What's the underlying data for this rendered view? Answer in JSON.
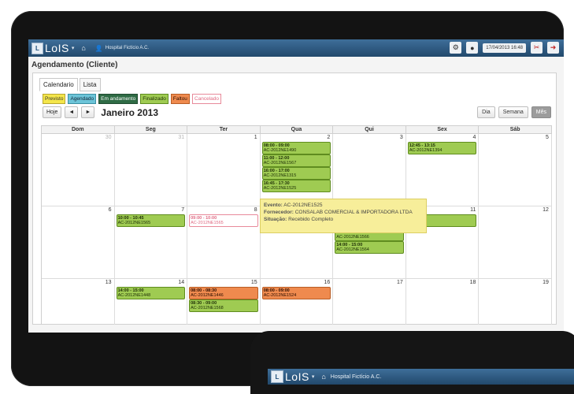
{
  "topbar": {
    "app_name": "LoIS",
    "caret": "▾",
    "home_icon": "⌂",
    "user_icon": "👤",
    "user_name": "Hospital Fictício A.C.",
    "datetime": "17/04/2013 16:48"
  },
  "page_title": "Agendamento (Cliente)",
  "tabs": [
    {
      "label": "Calendario"
    },
    {
      "label": "Lista"
    }
  ],
  "legend": [
    {
      "label": "Previsto",
      "bg": "#f4e64a",
      "border": "#b8a630",
      "color": "#333"
    },
    {
      "label": "Agendado",
      "bg": "#6cc4d8",
      "border": "#3a8fa3",
      "color": "#123"
    },
    {
      "label": "Em andamento",
      "bg": "#2f6b45",
      "border": "#214d31",
      "color": "#fff"
    },
    {
      "label": "Finalizado",
      "bg": "#9fcb52",
      "border": "#5f8c1f",
      "color": "#1c2d05"
    },
    {
      "label": "Faltou",
      "bg": "#ef8a4e",
      "border": "#b85d25",
      "color": "#2b0d00"
    },
    {
      "label": "Cancelado",
      "bg": "#ffffff",
      "border": "#e88a9a",
      "color": "#e06a82"
    }
  ],
  "toolbar": {
    "today": "Hoje",
    "prev": "◄",
    "next": "►",
    "month_title": "Janeiro 2013"
  },
  "views": [
    {
      "label": "Dia"
    },
    {
      "label": "Semana"
    },
    {
      "label": "Mês"
    }
  ],
  "weekdays": [
    "Dom",
    "Seg",
    "Ter",
    "Qua",
    "Qui",
    "Sex",
    "Sáb"
  ],
  "weeks": [
    [
      {
        "day": "30",
        "other": true,
        "events": []
      },
      {
        "day": "31",
        "other": true,
        "events": []
      },
      {
        "day": "1",
        "events": []
      },
      {
        "day": "2",
        "events": [
          {
            "time": "08:00 - 09:00",
            "code": "AC-2012NE1490",
            "status": "green"
          },
          {
            "time": "11:00 - 12:00",
            "code": "AC-2012NE1567",
            "status": "green"
          },
          {
            "time": "16:00 - 17:00",
            "code": "AC-2012NE1315",
            "status": "green"
          },
          {
            "time": "16:45 - 17:30",
            "code": "AC-2012NE1525",
            "status": "green"
          }
        ]
      },
      {
        "day": "3",
        "events": []
      },
      {
        "day": "4",
        "events": [
          {
            "time": "12:45 - 13:15",
            "code": "AC-2012NE1394",
            "status": "green"
          }
        ]
      },
      {
        "day": "5",
        "events": []
      }
    ],
    [
      {
        "day": "6",
        "events": []
      },
      {
        "day": "7",
        "events": [
          {
            "time": "10:00 - 10:45",
            "code": "AC-2012NE1565",
            "status": "green"
          }
        ]
      },
      {
        "day": "8",
        "events": [
          {
            "time": "09:00 - 10:00",
            "code": "AC-2012NE1565",
            "status": "cancel"
          }
        ]
      },
      {
        "day": "9",
        "events": []
      },
      {
        "day": "10",
        "events": [
          {
            "time": "11:00 - 12:00",
            "code": "AC-2012NE1566",
            "status": "green",
            "offset": 18
          },
          {
            "time": "14:00 - 15:00",
            "code": "AC-2012NE1564",
            "status": "green",
            "offset": 18
          }
        ]
      },
      {
        "day": "11",
        "events": [
          {
            "time": "…00",
            "code": "…E1514",
            "status": "green"
          }
        ]
      },
      {
        "day": "12",
        "events": []
      }
    ],
    [
      {
        "day": "13",
        "events": []
      },
      {
        "day": "14",
        "events": [
          {
            "time": "14:00 - 15:00",
            "code": "AC-2012NE1448",
            "status": "green"
          }
        ]
      },
      {
        "day": "15",
        "events": [
          {
            "time": "08:00 - 08:30",
            "code": "AC-2012NE1446",
            "status": "orange"
          },
          {
            "time": "08:30 - 09:00",
            "code": "AC-2012NE1568",
            "status": "green"
          }
        ]
      },
      {
        "day": "16",
        "events": [
          {
            "time": "08:00 - 09:00",
            "code": "AC-2012NE1524",
            "status": "orange"
          }
        ]
      },
      {
        "day": "17",
        "events": []
      },
      {
        "day": "18",
        "events": []
      },
      {
        "day": "19",
        "events": []
      }
    ]
  ],
  "tooltip": {
    "evento_label": "Evento:",
    "evento_value": "AC-2012NE1525",
    "fornecedor_label": "Fornecedor:",
    "fornecedor_value": "CONSALAB COMERCIAL & IMPORTADORA LTDA",
    "situacao_label": "Situação:",
    "situacao_value": "Recebido Completo"
  },
  "second_screen": {
    "app_name": "LoIS",
    "caret": "▾",
    "home_icon": "⌂",
    "user_name": "Hospital Fictício A.C."
  },
  "colors": {
    "green_bg": "#9fcb52",
    "green_border": "#5f8c1f",
    "orange_bg": "#ef8a4e",
    "orange_border": "#b85d25",
    "cancel_border": "#e88a9a",
    "cancel_text": "#e06a82"
  }
}
